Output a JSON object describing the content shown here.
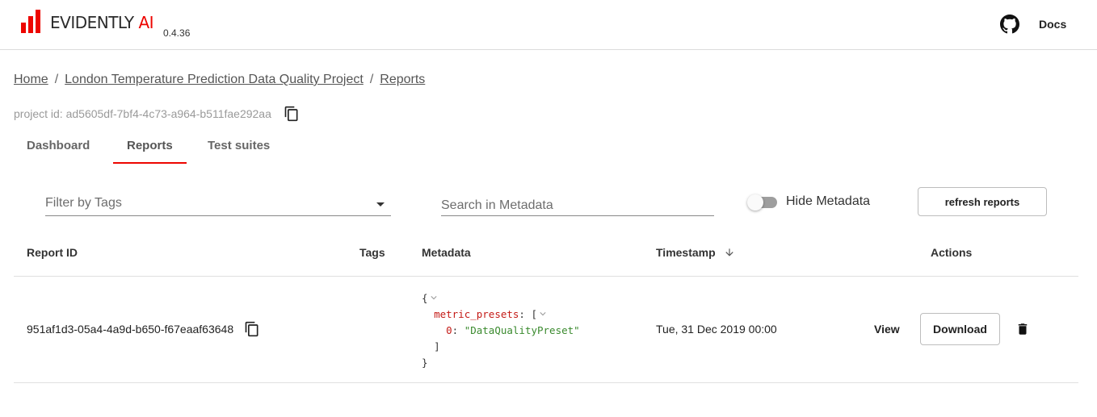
{
  "header": {
    "logo_text": "EVIDENTLY",
    "logo_ai": "AI",
    "version": "0.4.36",
    "github_icon": "github-icon",
    "docs_label": "Docs"
  },
  "breadcrumb": {
    "items": [
      "Home",
      "London Temperature Prediction Data Quality Project",
      "Reports"
    ],
    "separator": "/"
  },
  "project": {
    "id_text": "project id: ad5605df-7bf4-4c73-a964-b511fae292aa",
    "copy_icon": "copy-icon"
  },
  "tabs": [
    {
      "label": "Dashboard",
      "active": false
    },
    {
      "label": "Reports",
      "active": true
    },
    {
      "label": "Test suites",
      "active": false
    }
  ],
  "filters": {
    "tags_label": "Filter by Tags",
    "search_placeholder": "Search in Metadata",
    "hide_metadata_label": "Hide Metadata",
    "hide_metadata_on": false,
    "refresh_label": "refresh reports"
  },
  "table": {
    "columns": [
      "Report ID",
      "Tags",
      "Metadata",
      "Timestamp",
      "Actions"
    ],
    "sort_icon": "arrow-down-icon",
    "rows": [
      {
        "report_id": "951af1d3-05a4-4a9d-b650-f67eaaf63648",
        "tags": "",
        "metadata": {
          "open_brace": "{",
          "key": "metric_presets",
          "open_bracket": "[",
          "index": "0",
          "value": "\"DataQualityPreset\"",
          "close_bracket": "]",
          "close_brace": "}"
        },
        "timestamp": "Tue, 31 Dec 2019 00:00",
        "view_label": "View",
        "download_label": "Download",
        "delete_icon": "trash-icon"
      }
    ]
  },
  "colors": {
    "accent": "#ed0500",
    "json_key": "#c41a16",
    "json_string": "#3a8a2e"
  }
}
